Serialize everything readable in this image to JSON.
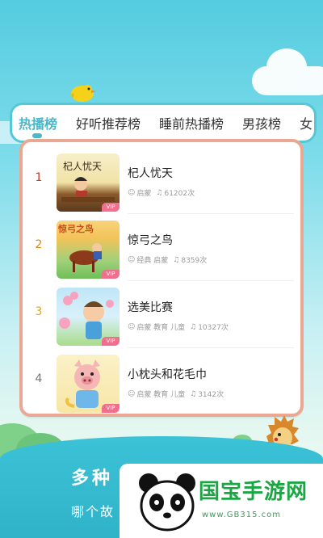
{
  "tabs": [
    {
      "label": "热播榜",
      "active": true
    },
    {
      "label": "好听推荐榜",
      "active": false
    },
    {
      "label": "睡前热播榜",
      "active": false
    },
    {
      "label": "男孩榜",
      "active": false
    },
    {
      "label": "女",
      "active": false
    }
  ],
  "list": [
    {
      "rank": "1",
      "title": "杞人忧天",
      "tags": "启蒙",
      "plays": "61202次",
      "thumb_text": "杞人忧天",
      "rank_color": "#c0392b"
    },
    {
      "rank": "2",
      "title": "惊弓之鸟",
      "tags": "经典 启蒙",
      "plays": "8359次",
      "thumb_text": "惊弓之鸟",
      "rank_color": "#d68a1a"
    },
    {
      "rank": "3",
      "title": "选美比赛",
      "tags": "启蒙 教育 儿童",
      "plays": "10327次",
      "rank_color": "#e0a81c"
    },
    {
      "rank": "4",
      "title": "小枕头和花毛巾",
      "tags": "启蒙 教育 儿童",
      "plays": "3142次",
      "rank_color": "#777777"
    }
  ],
  "vip_label": "VIP",
  "banner": {
    "line1": "多种",
    "line2": "哪个故"
  },
  "watermark": {
    "brand": "国宝手游网",
    "url": "www.GB315.com"
  },
  "colors": {
    "accent": "#4ab8c9",
    "card_border": "#eaa892",
    "watermark_green": "#1aa642"
  }
}
